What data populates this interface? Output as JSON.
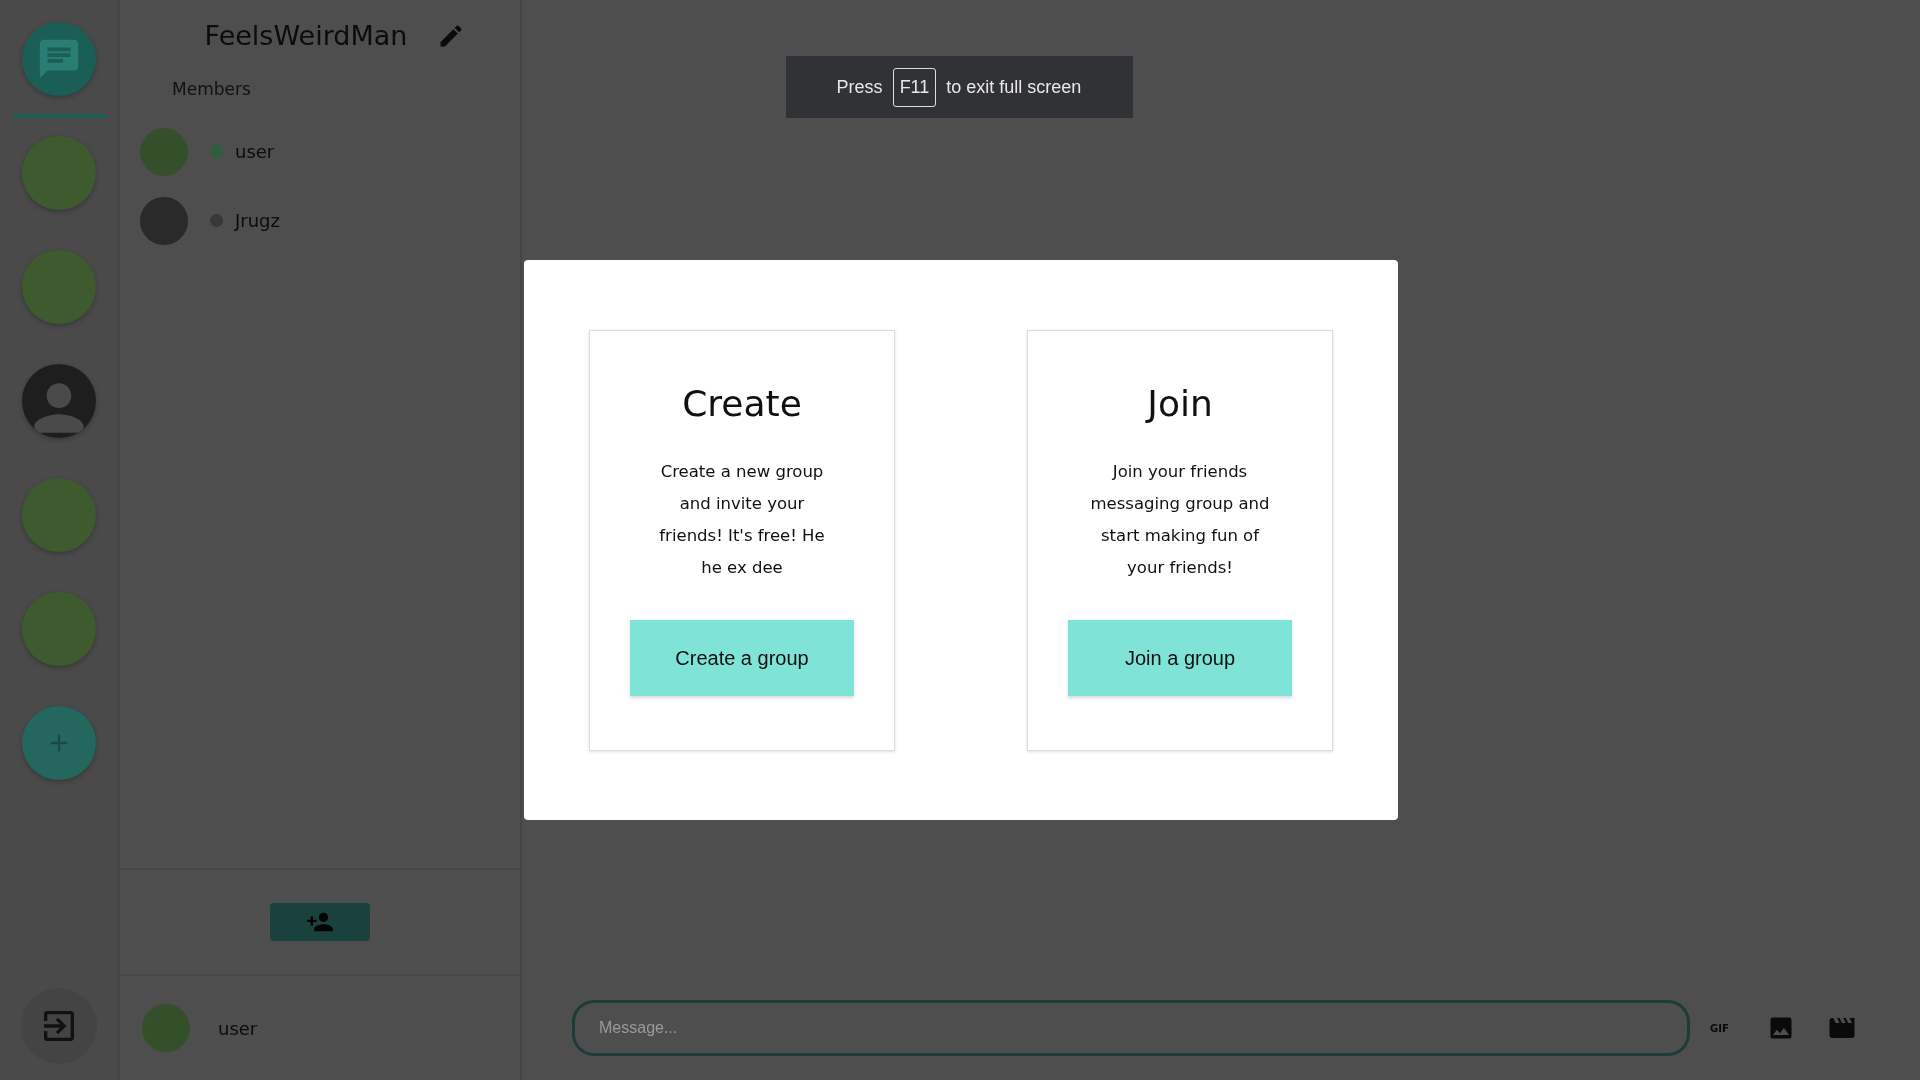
{
  "servers": [
    {
      "kind": "logo",
      "selected": true
    },
    {
      "kind": "avatar",
      "selected": false
    },
    {
      "kind": "avatar",
      "selected": false
    },
    {
      "kind": "default",
      "selected": false
    },
    {
      "kind": "avatar",
      "selected": false
    },
    {
      "kind": "avatar",
      "selected": false
    },
    {
      "kind": "add",
      "selected": false
    }
  ],
  "group": {
    "title": "FeelsWeirdMan",
    "members_label": "Members",
    "members": [
      {
        "name": "user",
        "color": "#2e5e3e"
      },
      {
        "name": "Jrugz",
        "color": "#383838"
      }
    ]
  },
  "current_user": {
    "name": "user"
  },
  "message": {
    "placeholder": "Message...",
    "gif_label": "GIF"
  },
  "fullscreen_notice": {
    "before": "Press",
    "key": "F11",
    "after": "to exit full screen"
  },
  "modal": {
    "cards": [
      {
        "title": "Create",
        "text": "Create a new group and invite your friends! It's free! He he ex dee",
        "button": "Create a group"
      },
      {
        "title": "Join",
        "text": "Join your friends messaging group and start making fun of your friends!",
        "button": "Join a group"
      }
    ]
  }
}
